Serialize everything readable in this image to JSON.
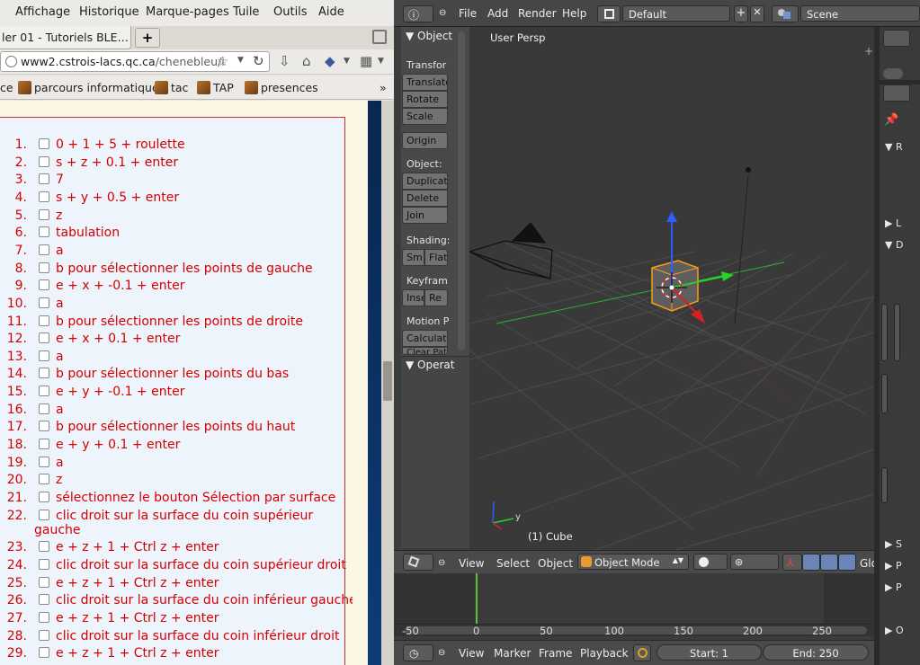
{
  "firefox": {
    "menu": [
      "Affichage",
      "Historique",
      "Marque-pages",
      "Tuile",
      "Outils",
      "Aide"
    ],
    "tab": {
      "title": "ler 01 - Tutoriels BLE…",
      "new_tab": "+"
    },
    "url": {
      "host": "www2.cstrois-lacs.qc.ca",
      "path": "/chenebleu/i"
    },
    "bookmarks": {
      "first": "ce",
      "items": [
        "parcours informatique",
        "tac",
        "TAP",
        "presences"
      ],
      "more": "»"
    },
    "steps": [
      {
        "n": "1.",
        "text": "0 + 1 + 5 + roulette"
      },
      {
        "n": "2.",
        "text": "s + z + 0.1 + enter"
      },
      {
        "n": "3.",
        "text": "7"
      },
      {
        "n": "4.",
        "text": "s + y + 0.5 + enter"
      },
      {
        "n": "5.",
        "text": "z"
      },
      {
        "n": "6.",
        "text": "tabulation"
      },
      {
        "n": "7.",
        "text": "a"
      },
      {
        "n": "8.",
        "text": "b pour sélectionner les points de gauche"
      },
      {
        "n": "9.",
        "text": "e + x + -0.1 + enter"
      },
      {
        "n": "10.",
        "text": "a"
      },
      {
        "n": "11.",
        "text": "b pour sélectionner les points de droite"
      },
      {
        "n": "12.",
        "text": "e + x + 0.1 + enter"
      },
      {
        "n": "13.",
        "text": "a"
      },
      {
        "n": "14.",
        "text": "b pour sélectionner les points du bas"
      },
      {
        "n": "15.",
        "text": "e + y + -0.1 + enter"
      },
      {
        "n": "16.",
        "text": "a"
      },
      {
        "n": "17.",
        "text": "b pour sélectionner les points du haut"
      },
      {
        "n": "18.",
        "text": "e + y + 0.1 + enter"
      },
      {
        "n": "19.",
        "text": "a"
      },
      {
        "n": "20.",
        "text": "z"
      },
      {
        "n": "21.",
        "text": "sélectionnez le bouton Sélection par surface"
      },
      {
        "n": "22.",
        "text": "clic droit sur la surface du coin supérieur",
        "text2": "gauche"
      },
      {
        "n": "23.",
        "text": "e + z + 1 + Ctrl z + enter"
      },
      {
        "n": "24.",
        "text": "clic droit sur la surface du coin supérieur droit"
      },
      {
        "n": "25.",
        "text": "e + z + 1 + Ctrl z + enter"
      },
      {
        "n": "26.",
        "text": "clic droit sur la surface du coin inférieur gauche"
      },
      {
        "n": "27.",
        "text": "e + z + 1 + Ctrl z + enter"
      },
      {
        "n": "28.",
        "text": "clic droit sur la surface du coin inférieur droit"
      },
      {
        "n": "29.",
        "text": "e + z + 1 + Ctrl z + enter"
      }
    ]
  },
  "blender": {
    "top_menu": [
      "File",
      "Add",
      "Render",
      "Help"
    ],
    "screen_layout": "Default",
    "scene": "Scene",
    "tools": {
      "object_tab": "Object",
      "transform_label": "Transfor",
      "transform_buttons": [
        "Translate",
        "Rotate",
        "Scale"
      ],
      "origin": "Origin",
      "object_label": "Object:",
      "object_buttons": [
        "Duplicat",
        "Delete",
        "Join"
      ],
      "shading_label": "Shading:",
      "shading_buttons": [
        "Sm",
        "Flat"
      ],
      "keyframe_label": "Keyfram",
      "keyframe_buttons": [
        "Inse",
        "Re"
      ],
      "motion_label": "Motion P",
      "motion_button": "Calculat",
      "motion_button2": "Clear Pat",
      "operator_panel": "Operat"
    },
    "viewport": {
      "title": "User Persp",
      "object_name": "(1) Cube"
    },
    "view_header": {
      "items": [
        "View",
        "Select",
        "Object"
      ],
      "mode": "Object Mode",
      "global": "Glo"
    },
    "timeline": {
      "numbers": [
        "-50",
        "0",
        "50",
        "100",
        "150",
        "200",
        "250"
      ],
      "current_frame_position": 0
    },
    "timeline_header": {
      "items": [
        "View",
        "Marker",
        "Frame",
        "Playback"
      ],
      "start": "Start: 1",
      "end": "End: 250"
    },
    "properties_letters": [
      "R",
      "L",
      "D",
      "S",
      "P",
      "P",
      "O"
    ],
    "colors": {
      "x_axis": "#d42222",
      "y_axis": "#2ad02a",
      "z_axis": "#2f5cff",
      "selection": "#ff9a1a",
      "timeline_frame": "#58c238"
    }
  }
}
